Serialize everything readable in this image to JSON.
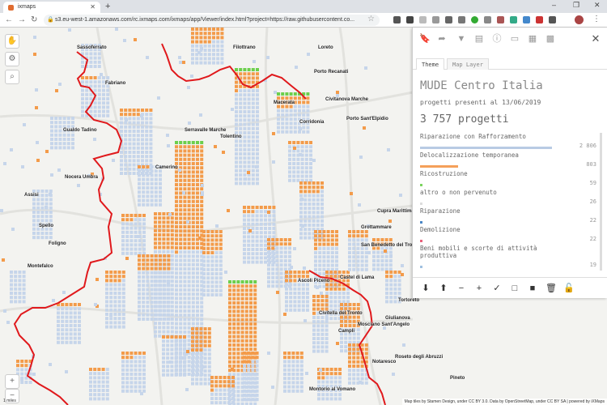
{
  "browser": {
    "tab_title": "ixmaps",
    "url": "s3.eu-west-1.amazonaws.com/rc.ixmaps.com/ixmaps/app/Viewer/index.html?project=https://raw.githubusercontent.co..."
  },
  "map": {
    "places": [
      "Sassoferrato",
      "Filottrano",
      "Loreto",
      "Porto Recanati",
      "Macerata",
      "Civitanova Marche",
      "Porto Sant'Elpidio",
      "Gualdo Tadino",
      "Serravalle Marche",
      "Tolentino",
      "Nocera Umbra",
      "Camerino",
      "Assisi",
      "Spello",
      "Foligno",
      "Cupra Marittima",
      "Grottammare",
      "San Benedetto del Tronto",
      "Montefalco",
      "Ascoli Piceno",
      "Castel di Lama",
      "Tortoreto",
      "Civitella del Tronto",
      "Giulianova",
      "Mosciano Sant'Angelo",
      "Campli",
      "Roseto degli Abruzzi",
      "Notaresco",
      "Pineto",
      "Montorio al Vomano",
      "Fabriano",
      "Corridonia"
    ],
    "attribution": "Map tiles by Stamen Design, under CC BY 3.0. Data by OpenStreetMap, under CC BY SA | powered by iXMaps",
    "scale": "1 miles"
  },
  "panel": {
    "tabs": [
      "Theme",
      "Map Layer"
    ],
    "title": "MUDE Centro Italia",
    "subtitle": "progetti presenti al 13/06/2019",
    "total": "3 757 progetti",
    "categories": [
      {
        "label": "Riparazione con Rafforzamento",
        "value": "2 806",
        "fraction": 0.746,
        "color": "#b8cbe4"
      },
      {
        "label": "Delocalizzazione temporanea",
        "value": "803",
        "fraction": 0.214,
        "color": "#f5a05a"
      },
      {
        "label": "Ricostruzione",
        "value": "59",
        "fraction": 0.016,
        "color": "#7bd35e"
      },
      {
        "label": "altro o non pervenuto",
        "value": "26",
        "fraction": 0.007,
        "color": "#dcdcdc"
      },
      {
        "label": "Riparazione",
        "value": "22",
        "fraction": 0.006,
        "color": "#4a86c5"
      },
      {
        "label": "Demolizione",
        "value": "22",
        "fraction": 0.006,
        "color": "#e8607a"
      },
      {
        "label": "Beni mobili e scorte di attività produttiva",
        "value": "19",
        "fraction": 0.005,
        "color": "#a0c0e0"
      }
    ]
  },
  "colors": {
    "boundary": "#e0191c",
    "cell_blue": "#c6d5ea",
    "cell_orange": "#f39b4a",
    "cell_green": "#6ccf4c"
  }
}
